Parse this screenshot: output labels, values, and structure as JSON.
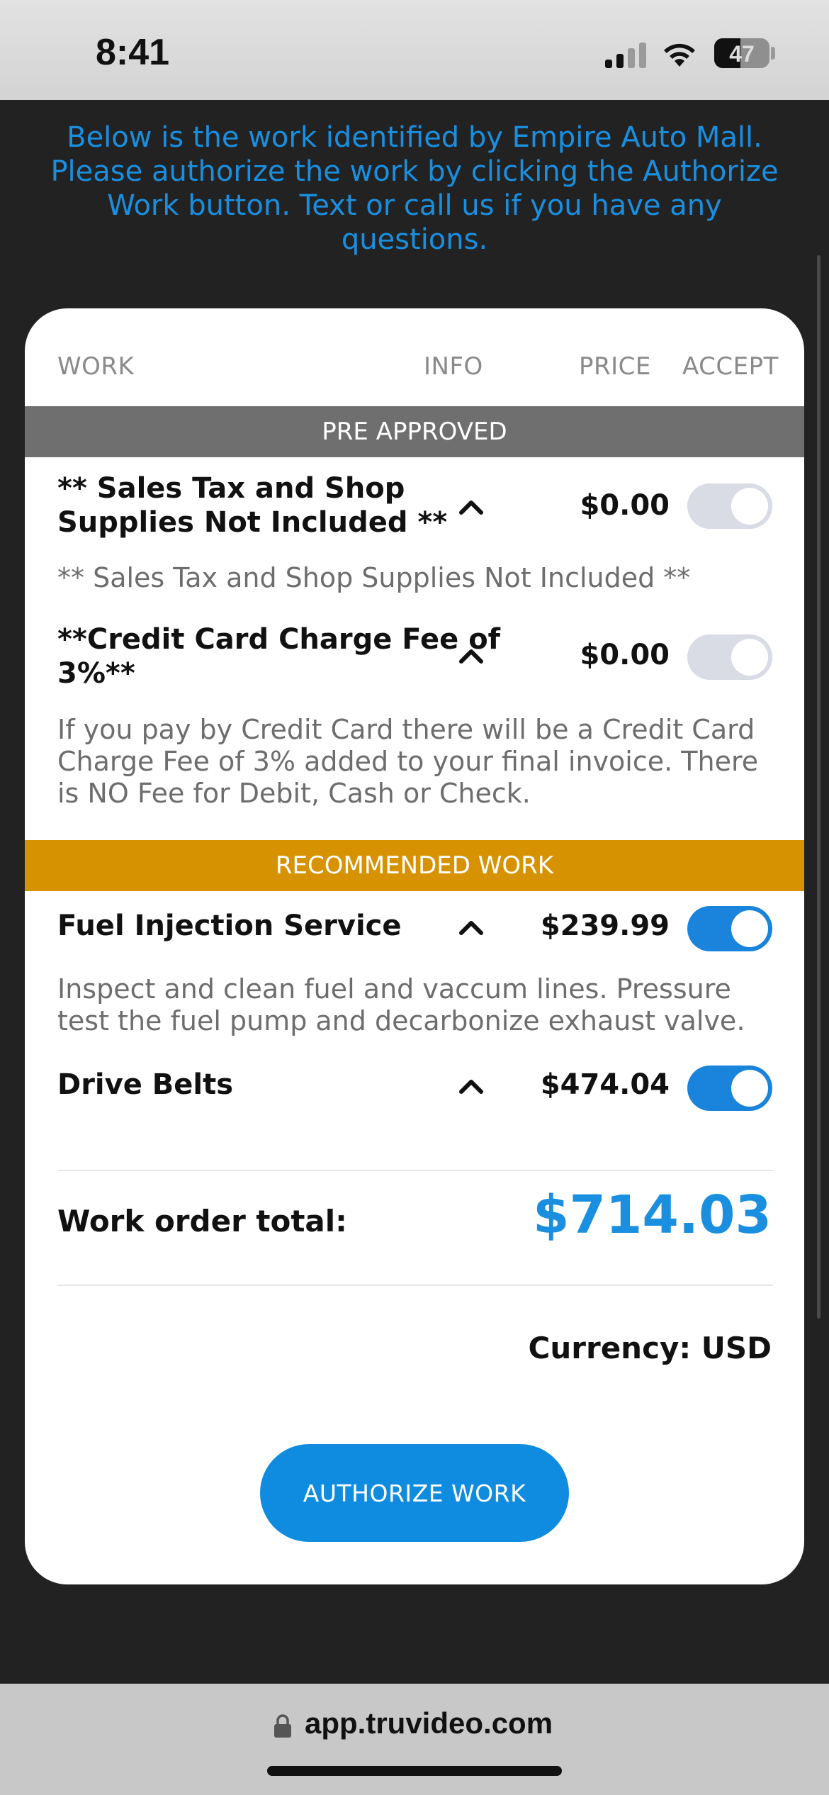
{
  "status_bar": {
    "time": "8:41",
    "battery": "47"
  },
  "intro_text": "Below is the work identified by Empire Auto Mall. Please authorize the work by clicking the Authorize Work button. Text or call us if you have any questions.",
  "columns": {
    "work": "WORK",
    "info": "INFO",
    "price": "PRICE",
    "accept": "ACCEPT"
  },
  "sections": {
    "pre_approved": {
      "label": "PRE APPROVED",
      "items": [
        {
          "title_line1": "** Sales Tax and Shop",
          "title_line2": "Supplies Not Included **",
          "price": "$0.00",
          "accepted": false,
          "description": "** Sales Tax and Shop Supplies Not Included **"
        },
        {
          "title_line1": "**Credit Card Charge Fee of",
          "title_line2": "3%**",
          "price": "$0.00",
          "accepted": false,
          "description": "If you pay by Credit Card there will be a Credit Card Charge Fee of 3% added to your final invoice. There is NO Fee for Debit, Cash or Check."
        }
      ]
    },
    "recommended": {
      "label": "RECOMMENDED WORK",
      "items": [
        {
          "title": "Fuel Injection Service",
          "price": "$239.99",
          "accepted": true,
          "description": "Inspect and clean fuel and vaccum lines. Pressure test the fuel pump and decarbonize exhaust valve."
        },
        {
          "title": "Drive Belts",
          "price": "$474.04",
          "accepted": true
        }
      ]
    }
  },
  "totals": {
    "label": "Work order total:",
    "value": "$714.03",
    "currency": "Currency: USD"
  },
  "authorize_button": "AUTHORIZE WORK",
  "url_bar": {
    "url": "app.truvideo.com"
  },
  "colors": {
    "accent": "#1a8fe0",
    "gold": "#d69200",
    "grey_band": "#6f6f6f"
  }
}
